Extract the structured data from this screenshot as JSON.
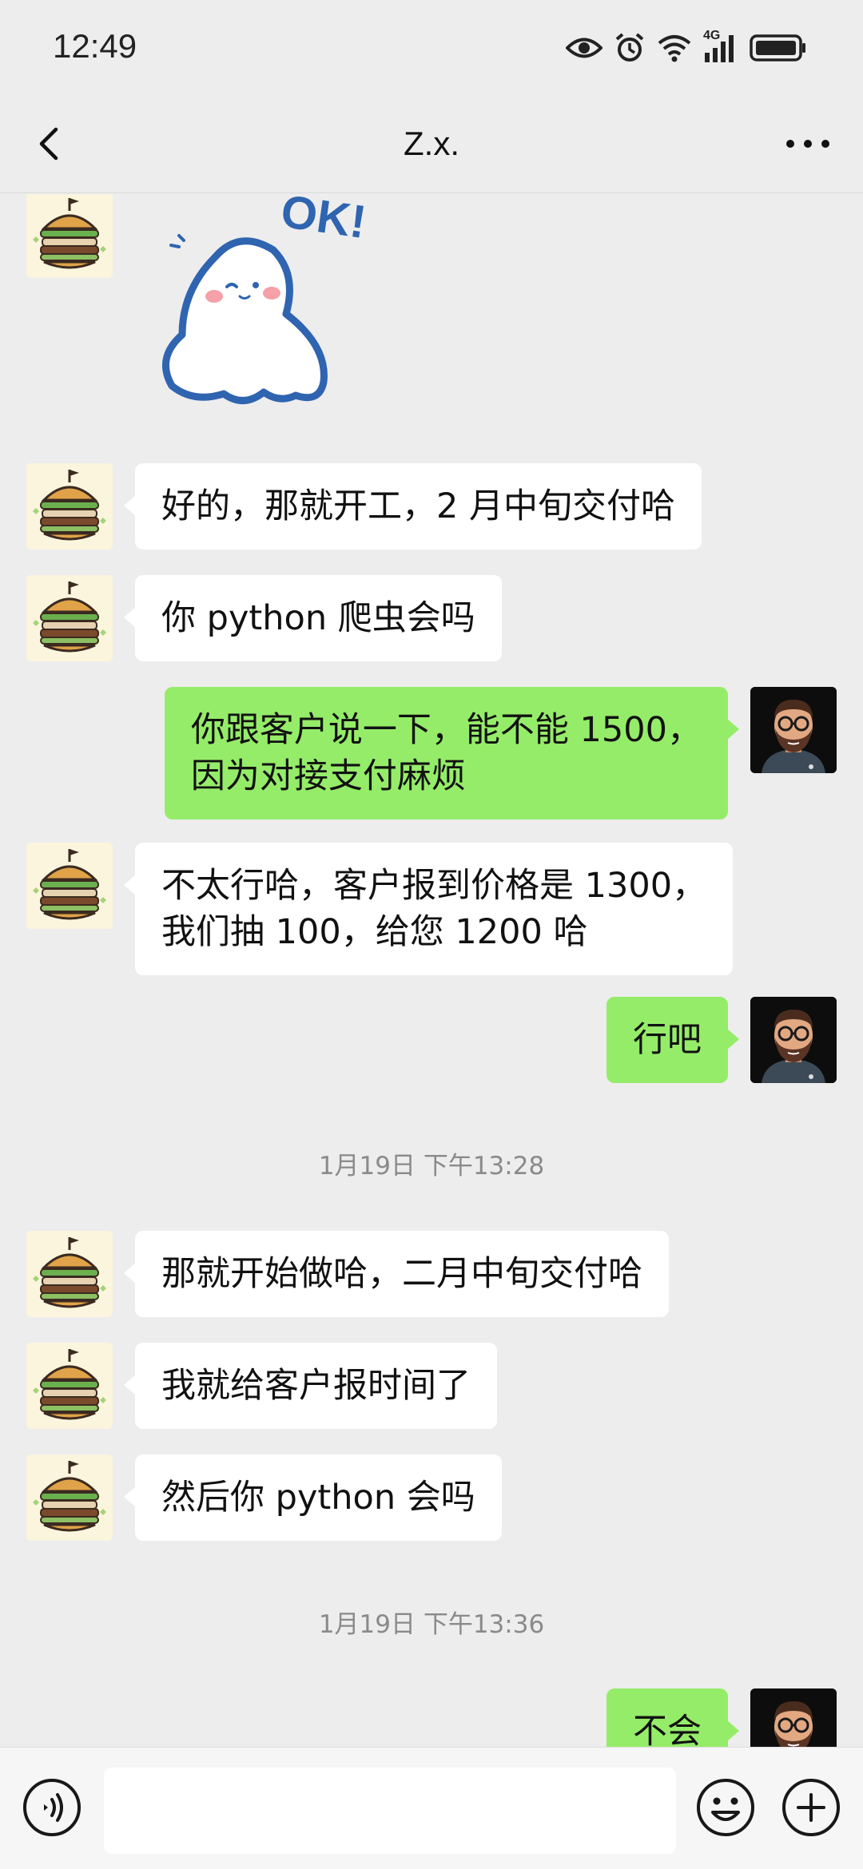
{
  "status_bar": {
    "time": "12:49",
    "network": "4G"
  },
  "header": {
    "title": "Z.x."
  },
  "messages": [
    {
      "from": "contact",
      "type": "sticker",
      "text": "OK!"
    },
    {
      "from": "contact",
      "type": "text",
      "text": "好的，那就开工，2 月中旬交付哈"
    },
    {
      "from": "contact",
      "type": "text",
      "text": "你 python 爬虫会吗"
    },
    {
      "from": "me",
      "type": "text",
      "text": "你跟客户说一下，能不能 1500，\n因为对接支付麻烦"
    },
    {
      "from": "contact",
      "type": "text",
      "text": "不太行哈，客户报到价格是 1300，\n我们抽 100，给您 1200 哈"
    },
    {
      "from": "me",
      "type": "text",
      "text": "行吧"
    },
    {
      "type": "timestamp",
      "text": "1月19日 下午13:28"
    },
    {
      "from": "contact",
      "type": "text",
      "text": "那就开始做哈，二月中旬交付哈"
    },
    {
      "from": "contact",
      "type": "text",
      "text": "我就给客户报时间了"
    },
    {
      "from": "contact",
      "type": "text",
      "text": "然后你 python 会吗"
    },
    {
      "type": "timestamp",
      "text": "1月19日 下午13:36"
    },
    {
      "from": "me",
      "type": "text",
      "text": "不会"
    }
  ],
  "input_bar": {
    "value": "",
    "icons": [
      "voice-icon",
      "emoji-icon",
      "plus-icon"
    ]
  },
  "colors": {
    "outgoing_bubble": "#95ec69",
    "incoming_bubble": "#ffffff",
    "background": "#ededed"
  }
}
